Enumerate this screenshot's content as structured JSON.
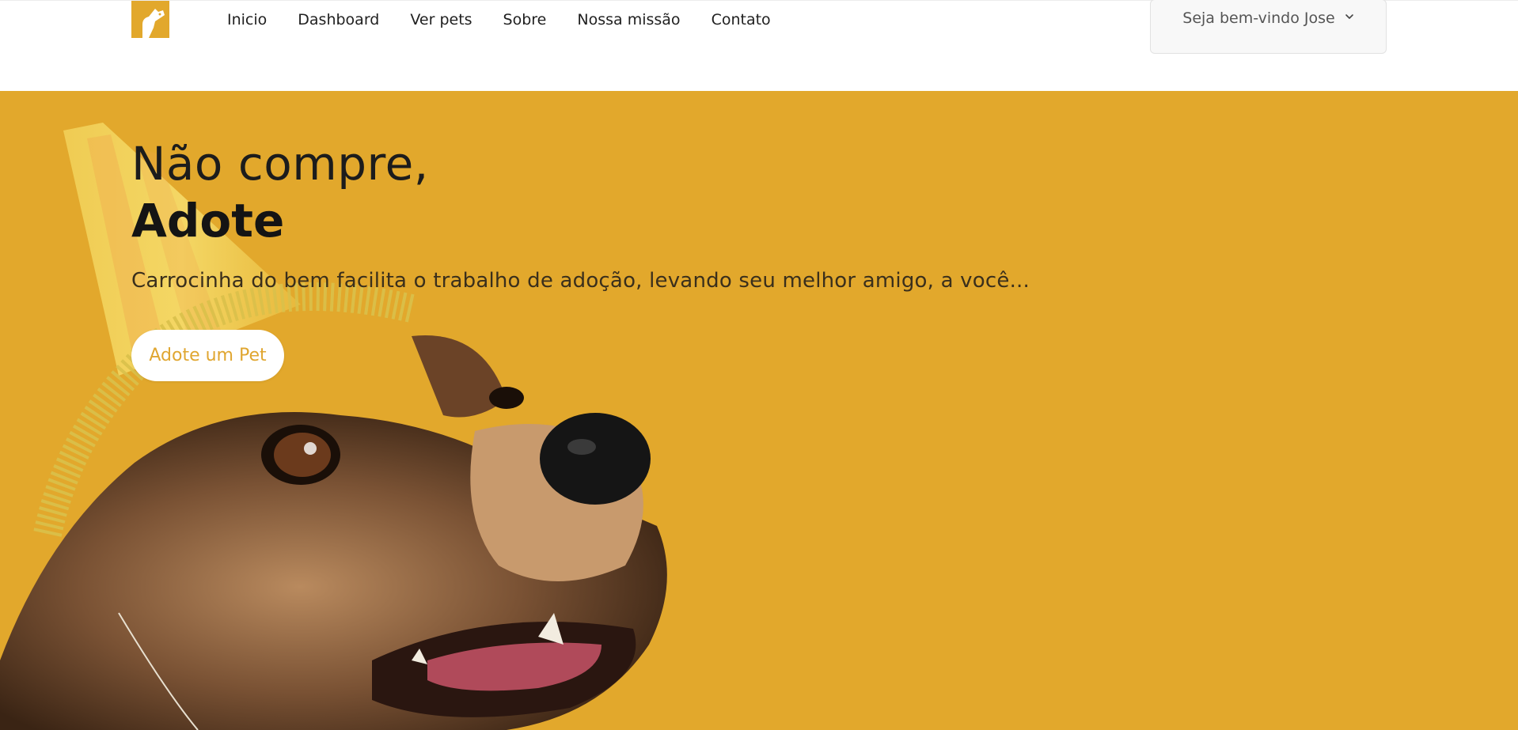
{
  "nav": {
    "items": [
      {
        "label": "Inicio"
      },
      {
        "label": "Dashboard"
      },
      {
        "label": "Ver pets"
      },
      {
        "label": "Sobre"
      },
      {
        "label": "Nossa missão"
      },
      {
        "label": "Contato"
      }
    ]
  },
  "user_menu": {
    "label": "Seja bem-vindo Jose",
    "icon": "chevron-down-icon"
  },
  "logo": {
    "icon": "dog-logo-icon",
    "color": "#e2a82c"
  },
  "hero": {
    "title_line1": "Não compre,",
    "title_line2": "Adote",
    "subtitle": "Carrocinha do bem facilita o trabalho de adoção, levando seu melhor amigo, a você...",
    "cta_label": "Adote um Pet",
    "background_color": "#e2a82c",
    "image": "dog-with-party-hat"
  },
  "colors": {
    "accent": "#e2a82c",
    "text_dark": "#1c1c1c",
    "cta_text": "#e0a630"
  }
}
